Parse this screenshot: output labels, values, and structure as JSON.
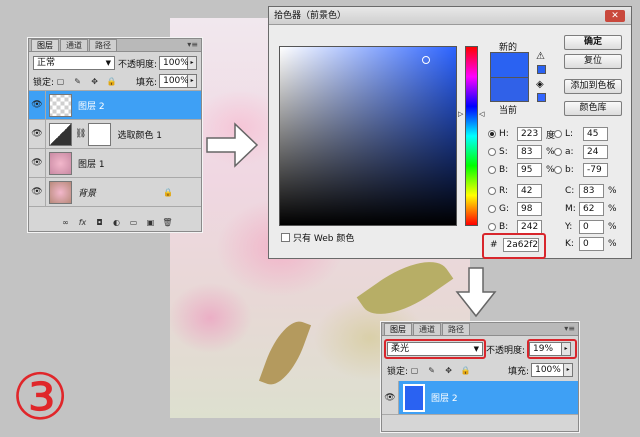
{
  "step_number": "③",
  "left_panel": {
    "tabs": [
      "图层",
      "通道",
      "路径"
    ],
    "menu_icon": "panel-menu-icon",
    "blend_mode": "正常",
    "opacity_label": "不透明度:",
    "opacity_value": "100%",
    "lock_label": "锁定:",
    "fill_label": "填充:",
    "fill_value": "100%",
    "layers": [
      {
        "name": "图层 2",
        "selected": true
      },
      {
        "name": "选取颜色 1",
        "selected": false
      },
      {
        "name": "图层 1",
        "selected": false
      },
      {
        "name": "背景",
        "selected": false
      }
    ]
  },
  "color_picker": {
    "title": "拾色器（前景色）",
    "close_label": "✕",
    "new_label": "新的",
    "current_label": "当前",
    "new_color": "#2a62f2",
    "current_color": "#3061e8",
    "buttons": {
      "ok": "确定",
      "reset": "复位",
      "add_swatch": "添加到色板",
      "color_libraries": "颜色库"
    },
    "web_only_label": "只有 Web 颜色",
    "fields": {
      "H": {
        "label": "H:",
        "value": "223",
        "unit": "度"
      },
      "S": {
        "label": "S:",
        "value": "83",
        "unit": "%"
      },
      "B": {
        "label": "B:",
        "value": "95",
        "unit": "%"
      },
      "R": {
        "label": "R:",
        "value": "42",
        "unit": ""
      },
      "G": {
        "label": "G:",
        "value": "98",
        "unit": ""
      },
      "Bl": {
        "label": "B:",
        "value": "242",
        "unit": ""
      },
      "L": {
        "label": "L:",
        "value": "45",
        "unit": ""
      },
      "a": {
        "label": "a:",
        "value": "24",
        "unit": ""
      },
      "b": {
        "label": "b:",
        "value": "-79",
        "unit": ""
      },
      "C": {
        "label": "C:",
        "value": "83",
        "unit": "%"
      },
      "M": {
        "label": "M:",
        "value": "62",
        "unit": "%"
      },
      "Y": {
        "label": "Y:",
        "value": "0",
        "unit": "%"
      },
      "K": {
        "label": "K:",
        "value": "0",
        "unit": "%"
      }
    },
    "hex_label": "#",
    "hex_value": "2a62f2"
  },
  "bottom_panel": {
    "tabs": [
      "图层",
      "通道",
      "路径"
    ],
    "blend_mode": "柔光",
    "opacity_label": "不透明度:",
    "opacity_value": "19%",
    "lock_label": "锁定:",
    "fill_label": "填充:",
    "fill_value": "100%",
    "layer_name": "图层 2"
  },
  "colors": {
    "selection_blue": "#3ea0f5",
    "highlight_red": "#d8262c",
    "layer_fill": "#2a62f2"
  }
}
